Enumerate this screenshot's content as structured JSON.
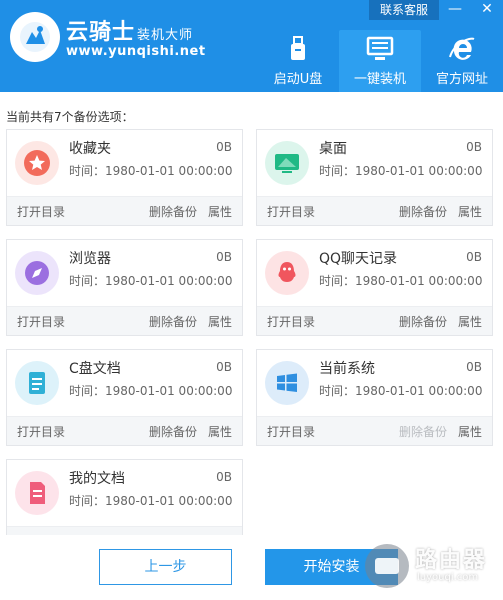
{
  "app": {
    "brand_title": "云骑士",
    "brand_sub": "装机大师",
    "brand_url": "www.yunqishi.net"
  },
  "topbar": {
    "contact_label": "联系客服",
    "minimize_label": "—",
    "close_label": "✕"
  },
  "nav": {
    "items": [
      {
        "label": "启动U盘",
        "icon": "usb-icon"
      },
      {
        "label": "一键装机",
        "icon": "monitor-icon",
        "active": true
      },
      {
        "label": "官方网址",
        "icon": "ie-icon"
      }
    ]
  },
  "main": {
    "summary": "当前共有7个备份选项：",
    "actions": {
      "open": "打开目录",
      "delete": "删除备份",
      "props": "属性"
    },
    "cards": [
      {
        "name": "收藏夹",
        "size": "0B",
        "time": "时间：1980-01-01 00:00:00",
        "icon": "star-icon",
        "color": "#f26b5b"
      },
      {
        "name": "桌面",
        "size": "0B",
        "time": "时间：1980-01-01 00:00:00",
        "icon": "desktop-icon",
        "color": "#20b985"
      },
      {
        "name": "浏览器",
        "size": "0B",
        "time": "时间：1980-01-01 00:00:00",
        "icon": "compass-icon",
        "color": "#9b6fe0"
      },
      {
        "name": "QQ聊天记录",
        "size": "0B",
        "time": "时间：1980-01-01 00:00:00",
        "icon": "qq-icon",
        "color": "#f0565e"
      },
      {
        "name": "C盘文档",
        "size": "0B",
        "time": "时间：1980-01-01 00:00:00",
        "icon": "document-icon",
        "color": "#2fb0d6"
      },
      {
        "name": "当前系统",
        "size": "0B",
        "time": "时间：1980-01-01 00:00:00",
        "icon": "windows-icon",
        "color": "#2f8fe0"
      },
      {
        "name": "我的文档",
        "size": "0B",
        "time": "时间：1980-01-01 00:00:00",
        "icon": "my-docs-icon",
        "color": "#ef5d7b"
      }
    ]
  },
  "footer": {
    "prev_label": "上一步",
    "start_label": "开始安装"
  },
  "watermark": {
    "title": "路由器",
    "url": "luyouqi.com"
  }
}
